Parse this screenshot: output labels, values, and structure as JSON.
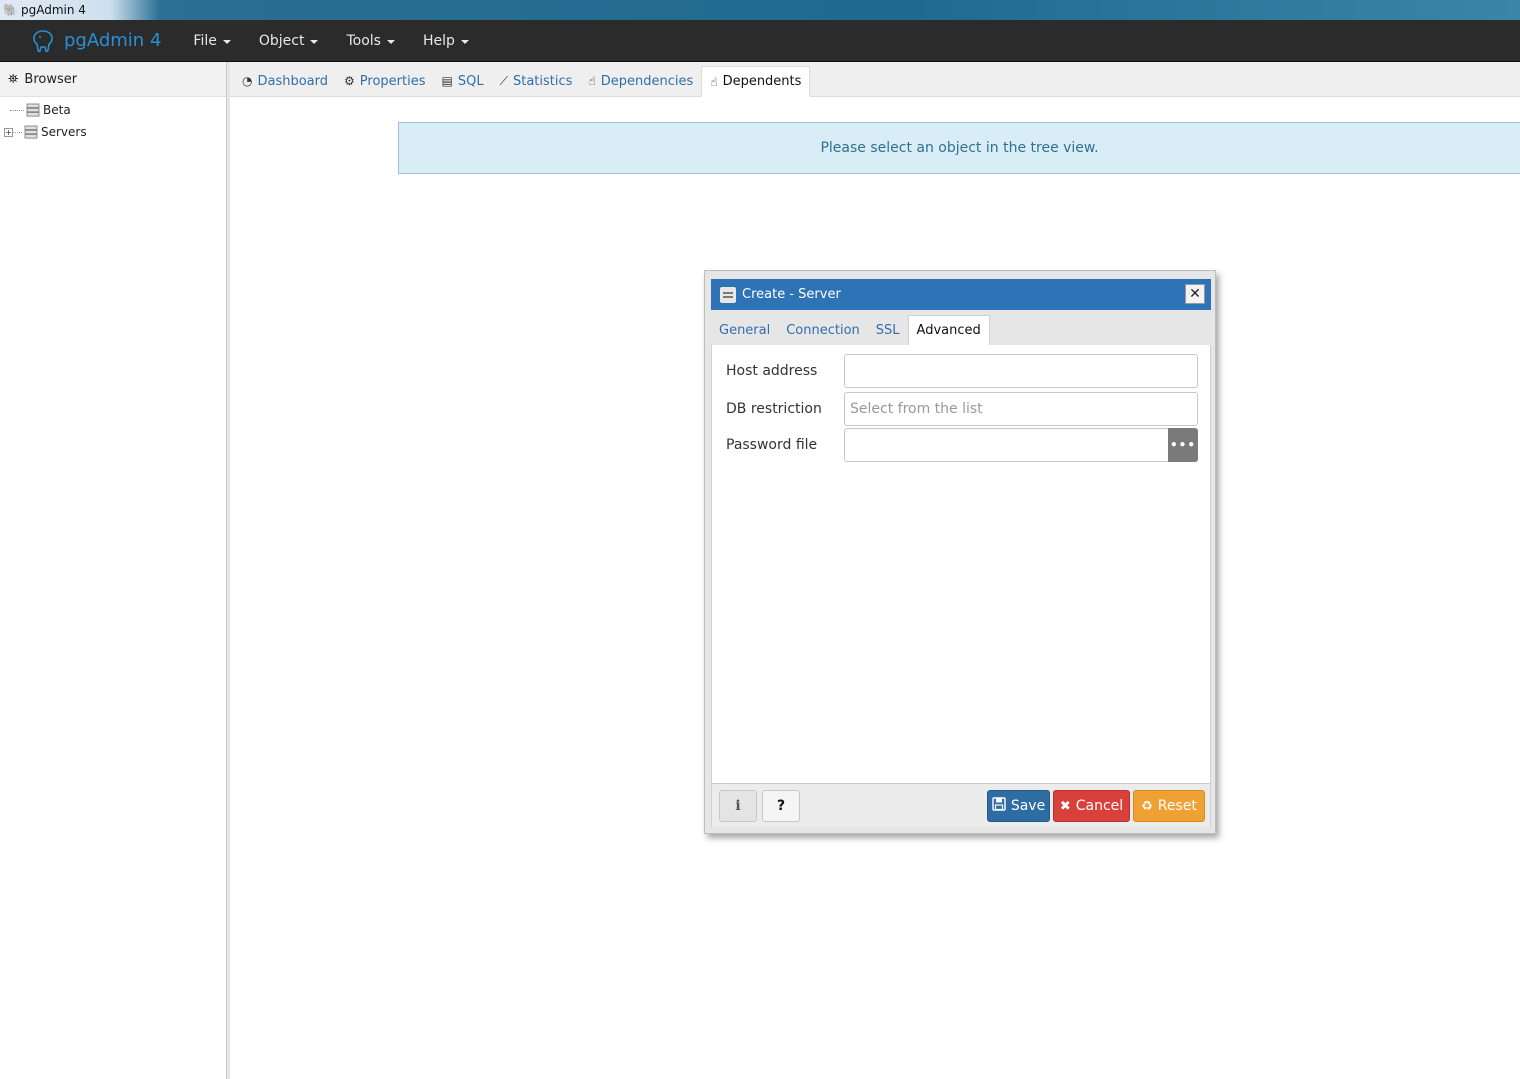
{
  "os": {
    "title": "pgAdmin 4"
  },
  "app": {
    "brand": "pgAdmin 4"
  },
  "menu": [
    {
      "label": "File"
    },
    {
      "label": "Object"
    },
    {
      "label": "Tools"
    },
    {
      "label": "Help"
    }
  ],
  "browser": {
    "title": "Browser",
    "tree": [
      {
        "label": "Beta"
      },
      {
        "label": "Servers"
      }
    ]
  },
  "tabs": [
    {
      "label": "Dashboard",
      "icon": "dashboard-icon"
    },
    {
      "label": "Properties",
      "icon": "cogs-icon"
    },
    {
      "label": "SQL",
      "icon": "file-text-icon"
    },
    {
      "label": "Statistics",
      "icon": "line-chart-icon"
    },
    {
      "label": "Dependencies",
      "icon": "hand-icon"
    },
    {
      "label": "Dependents",
      "icon": "hand-icon",
      "active": true
    }
  ],
  "main": {
    "message": "Please select an object in the tree view."
  },
  "dialog": {
    "title": "Create - Server",
    "tabs": [
      {
        "label": "General"
      },
      {
        "label": "Connection"
      },
      {
        "label": "SSL"
      },
      {
        "label": "Advanced",
        "active": true
      }
    ],
    "fields": {
      "host_address": {
        "label": "Host address",
        "value": "",
        "placeholder": ""
      },
      "db_restriction": {
        "label": "DB restriction",
        "value": "",
        "placeholder": "Select from the list"
      },
      "password_file": {
        "label": "Password file",
        "value": "",
        "placeholder": ""
      }
    },
    "buttons": {
      "info": "i",
      "help": "?",
      "save": "Save",
      "cancel": "Cancel",
      "reset": "Reset"
    }
  },
  "colors": {
    "navbar": "#2b2b2b",
    "brand": "#2a8fd6",
    "dialog_header": "#2e73b5",
    "save": "#2e6da4",
    "cancel": "#d9403a",
    "reset": "#f0a134",
    "alert_bg": "#d9edf7"
  }
}
